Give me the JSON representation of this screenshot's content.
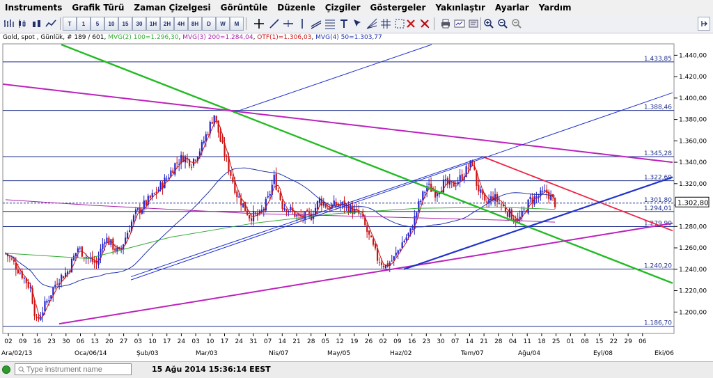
{
  "menu": [
    "Instruments",
    "Grafik Türü",
    "Zaman Çizelgesi",
    "Görüntüle",
    "Düzenle",
    "Çizgiler",
    "Göstergeler",
    "Yakınlaştır",
    "Ayarlar",
    "Yardım"
  ],
  "toolbar": {
    "timeframes": [
      "T",
      "1",
      "5",
      "10",
      "15",
      "30",
      "1H",
      "2H",
      "4H",
      "8H",
      "D",
      "W",
      "M"
    ]
  },
  "chart_info": {
    "instrument": "Gold, spot , Günlük, # 189 / 601",
    "mvg2": "MVG(2) 100=1.296,30",
    "mvg3": "MVG(3) 200=1.284,04",
    "otf": "OTF(1)=1.306,03",
    "mvg4": "MVG(4) 50=1.303,77"
  },
  "colors": {
    "up": "#2222cc",
    "down": "#cc1111",
    "ma_red": "#cc1111",
    "ma_green": "#33aa33",
    "ma_blue": "#2233aa",
    "ma_purple": "#aa22aa",
    "trend_green": "#22bb22",
    "trend_magenta": "#bb22bb",
    "trend_red": "#ee2244",
    "trend_blue": "#2233cc"
  },
  "chart_data": {
    "type": "candlestick",
    "ylim": [
      1180,
      1450
    ],
    "y_ticks": [
      "1.200,00",
      "1.220,00",
      "1.240,00",
      "1.260,00",
      "1.280,00",
      "1.300,00",
      "1.320,00",
      "1.340,00",
      "1.360,00",
      "1.380,00",
      "1.400,00",
      "1.420,00",
      "1.440,00"
    ],
    "y_tick_values": [
      1200,
      1220,
      1240,
      1260,
      1280,
      1300,
      1320,
      1340,
      1360,
      1380,
      1400,
      1420,
      1440
    ],
    "x_ticks": [
      "02",
      "09",
      "16",
      "23",
      "30",
      "06",
      "13",
      "20",
      "27",
      "03",
      "10",
      "17",
      "24",
      "03",
      "10",
      "17",
      "24",
      "31",
      "07",
      "14",
      "21",
      "28",
      "05",
      "12",
      "19",
      "26",
      "02",
      "09",
      "16",
      "23",
      "30",
      "07",
      "14",
      "21",
      "28",
      "04",
      "11",
      "18",
      "25",
      "01",
      "08",
      "15",
      "22",
      "29",
      "06"
    ],
    "x_months": [
      "Ara/02/13",
      "Oca/06/14",
      "Şub/03",
      "Mar/03",
      "Nis/07",
      "May/05",
      "Haz/02",
      "Tem/07",
      "Ağu/04",
      "Eyl/08",
      "Eki/06"
    ],
    "levels": [
      {
        "label": "1.433,85",
        "value": 1433.85
      },
      {
        "label": "1.388,46",
        "value": 1388.46
      },
      {
        "label": "1.345,28",
        "value": 1345.28
      },
      {
        "label": "1.322,69",
        "value": 1322.69
      },
      {
        "label": "1.301,80",
        "value": 1301.8
      },
      {
        "label": "1.294,01",
        "value": 1294.01
      },
      {
        "label": "1.279,90",
        "value": 1279.9
      },
      {
        "label": "1.240,20",
        "value": 1240.2
      },
      {
        "label": "1.186,70",
        "value": 1186.7
      }
    ],
    "last_price": "1.302,80",
    "last_value": 1302.8,
    "anchors": [
      [
        0,
        1255
      ],
      [
        3,
        1248
      ],
      [
        8,
        1235
      ],
      [
        12,
        1222
      ],
      [
        15,
        1190
      ],
      [
        20,
        1210
      ],
      [
        25,
        1230
      ],
      [
        30,
        1238
      ],
      [
        35,
        1260
      ],
      [
        40,
        1250
      ],
      [
        44,
        1245
      ],
      [
        48,
        1270
      ],
      [
        55,
        1255
      ],
      [
        60,
        1280
      ],
      [
        63,
        1292
      ],
      [
        67,
        1300
      ],
      [
        72,
        1310
      ],
      [
        78,
        1325
      ],
      [
        82,
        1338
      ],
      [
        86,
        1345
      ],
      [
        90,
        1340
      ],
      [
        95,
        1355
      ],
      [
        99,
        1375
      ],
      [
        101,
        1385
      ],
      [
        104,
        1360
      ],
      [
        108,
        1335
      ],
      [
        112,
        1310
      ],
      [
        118,
        1290
      ],
      [
        123,
        1290
      ],
      [
        127,
        1305
      ],
      [
        130,
        1325
      ],
      [
        134,
        1300
      ],
      [
        138,
        1295
      ],
      [
        142,
        1288
      ],
      [
        148,
        1290
      ],
      [
        152,
        1305
      ],
      [
        156,
        1298
      ],
      [
        160,
        1300
      ],
      [
        164,
        1300
      ],
      [
        168,
        1295
      ],
      [
        172,
        1290
      ],
      [
        176,
        1270
      ],
      [
        180,
        1250
      ],
      [
        184,
        1243
      ],
      [
        188,
        1250
      ],
      [
        192,
        1265
      ],
      [
        196,
        1275
      ],
      [
        200,
        1300
      ],
      [
        204,
        1318
      ],
      [
        208,
        1312
      ],
      [
        212,
        1320
      ],
      [
        216,
        1318
      ],
      [
        220,
        1325
      ],
      [
        224,
        1335
      ],
      [
        226,
        1340
      ],
      [
        228,
        1320
      ],
      [
        232,
        1300
      ],
      [
        236,
        1308
      ],
      [
        240,
        1300
      ],
      [
        244,
        1292
      ],
      [
        248,
        1285
      ],
      [
        250,
        1290
      ],
      [
        254,
        1305
      ],
      [
        258,
        1308
      ],
      [
        262,
        1312
      ],
      [
        266,
        1302
      ]
    ],
    "series": [
      {
        "name": "MVG(2) 100",
        "values": [
          1250,
          1260,
          1275,
          1290,
          1294,
          1296,
          1298,
          1299,
          1300,
          1296
        ]
      },
      {
        "name": "MVG(3) 200",
        "values": [
          1300,
          1304,
          1300,
          1295,
          1294,
          1291,
          1288,
          1287,
          1285,
          1284
        ]
      },
      {
        "name": "MVG(4) 50",
        "values": [
          1300,
          1250,
          1235,
          1255,
          1285,
          1316,
          1313,
          1300,
          1290,
          1288,
          1300,
          1303
        ]
      },
      {
        "name": "OTF(1)",
        "values": [
          1340,
          1300,
          1260,
          1250,
          1270,
          1290,
          1300,
          1295,
          1290,
          1300,
          1306
        ]
      }
    ]
  },
  "statusbar": {
    "placeholder": "Type instrument name",
    "datetime": "15 Ağu 2014 15:36:14 EEST"
  }
}
